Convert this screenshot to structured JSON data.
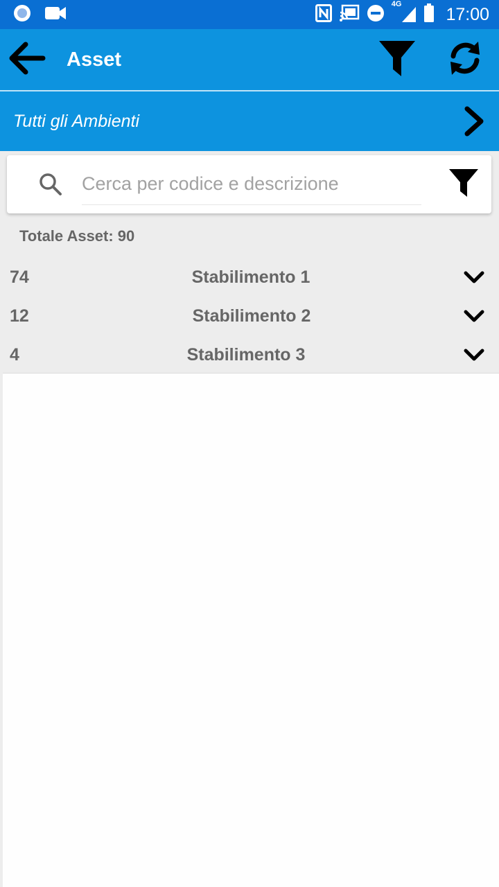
{
  "status_bar": {
    "time": "17:00",
    "network_label": "4G",
    "icons": [
      "record-icon",
      "video-icon",
      "nfc-icon",
      "cast-icon",
      "dnd-icon",
      "signal-icon",
      "battery-icon"
    ]
  },
  "app_bar": {
    "title": "Asset",
    "icons": [
      "back-arrow-icon",
      "filter-icon",
      "refresh-icon"
    ]
  },
  "environment": {
    "label": "Tutti gli Ambienti"
  },
  "search": {
    "placeholder": "Cerca per codice e descrizione",
    "value": ""
  },
  "summary": {
    "total_text": "Totale Asset: 90"
  },
  "groups": [
    {
      "count": "74",
      "name": "Stabilimento 1"
    },
    {
      "count": "12",
      "name": "Stabilimento 2"
    },
    {
      "count": "4",
      "name": "Stabilimento 3"
    }
  ],
  "colors": {
    "status_bar": "#0a6fd3",
    "app_bar": "#0d93df",
    "list_background": "#ededed",
    "text_gray": "#666666"
  }
}
